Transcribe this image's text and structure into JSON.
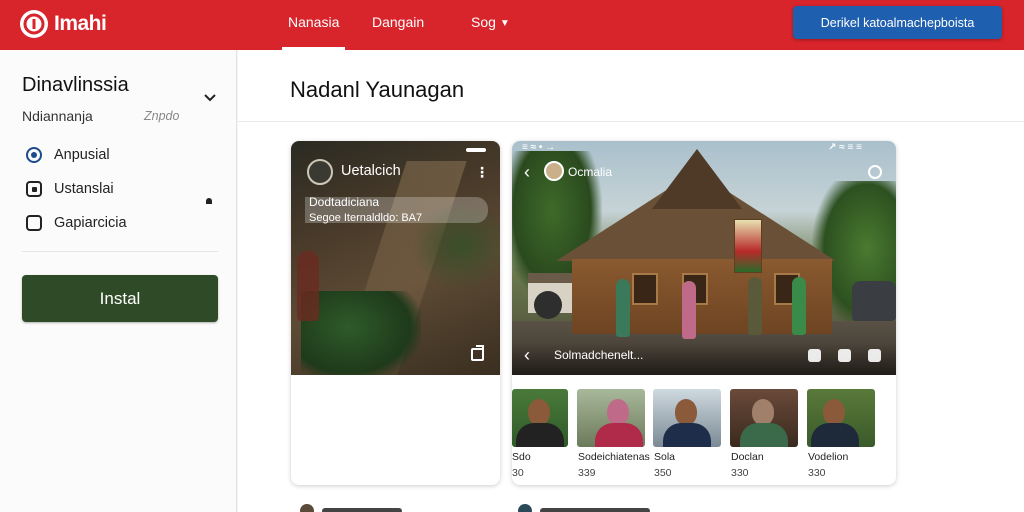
{
  "app": {
    "logo_text": "Imahi"
  },
  "nav": {
    "items": [
      "Nanasia",
      "Dangain",
      "Sog"
    ],
    "cta": "Derikel katoalmachepboista"
  },
  "sidebar": {
    "title": "Dinavlinssia",
    "subtitle": "Ndiannanja",
    "subtitle_hint": "Znpdo",
    "options": [
      {
        "label": "Anpusial",
        "state": "selected"
      },
      {
        "label": "Ustanslai",
        "state": "partial"
      },
      {
        "label": "Gapiarcicia",
        "state": "unchecked"
      }
    ],
    "install_label": "Instal"
  },
  "main": {
    "title": "Nadanl Yaunagan",
    "card_left": {
      "name": "Uetalcich",
      "caption_title": "Dodtadiciana",
      "caption_sub": "Segoe Iternaldldo: BA7"
    },
    "card_right": {
      "status_left": "≡ ≈ • →",
      "status_right": "↗ ≈ ≡ ≡",
      "name": "Ocmalia",
      "caption": "Solmadchenelt..."
    },
    "thumbnails": [
      {
        "name": "Sdo",
        "count": "30"
      },
      {
        "name": "Sodeichiatenas",
        "count": "339"
      },
      {
        "name": "Sola",
        "count": "350"
      },
      {
        "name": "Doclan",
        "count": "330"
      },
      {
        "name": "Vodelion",
        "count": "330"
      }
    ]
  },
  "colors": {
    "topbar": "#d8242b",
    "cta": "#1f5fb0",
    "install": "#2e4a26"
  }
}
